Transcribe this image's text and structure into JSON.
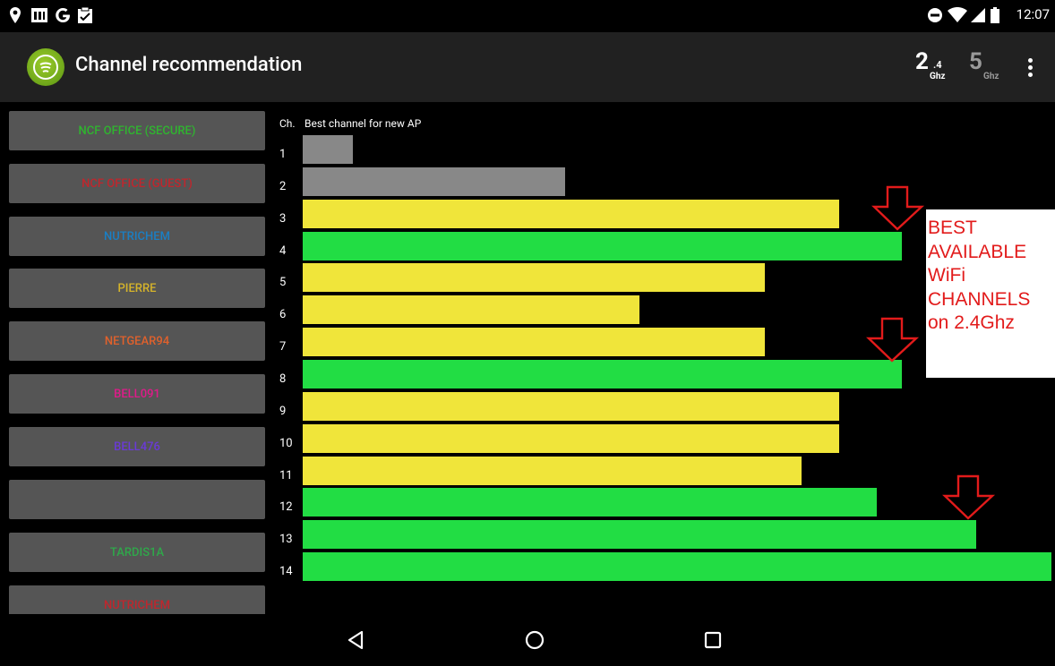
{
  "status_bar": {
    "time": "12:07",
    "left_icons": [
      "location-pin-icon",
      "news-icon",
      "google-icon",
      "clipboard-icon"
    ],
    "right_icons": [
      "do-not-disturb-icon",
      "wifi-icon",
      "cell-signal-icon",
      "battery-icon"
    ]
  },
  "app_bar": {
    "title": "Channel recommendation",
    "band_24": {
      "main": "2",
      "sup": ".4",
      "unit": "Ghz"
    },
    "band_5": {
      "main": "5",
      "unit": "Ghz"
    },
    "menu_icon": "overflow-menu-icon"
  },
  "networks": [
    {
      "name": "NCF OFFICE (SECURE)",
      "color": "#2fb52f"
    },
    {
      "name": "NCF OFFICE (GUEST)",
      "color": "#c0262d"
    },
    {
      "name": "NUTRICHEM",
      "color": "#1a7fc4"
    },
    {
      "name": "PIERRE",
      "color": "#d6b42a"
    },
    {
      "name": "NETGEAR94",
      "color": "#e0612c"
    },
    {
      "name": "BELL091",
      "color": "#e01a8a"
    },
    {
      "name": "BELL476",
      "color": "#6a3ad6"
    },
    {
      "name": "",
      "color": "#ffffff"
    },
    {
      "name": "TARDIS1A",
      "color": "#2fa84a"
    },
    {
      "name": "NUTRICHEM",
      "color": "#c0262d"
    }
  ],
  "chart_data": {
    "type": "bar",
    "orientation": "horizontal",
    "header_ch": "Ch.",
    "title": "Best channel for new AP",
    "categories": [
      "1",
      "2",
      "3",
      "4",
      "5",
      "6",
      "7",
      "8",
      "9",
      "10",
      "11",
      "12",
      "13",
      "14"
    ],
    "values": [
      0.067,
      0.35,
      0.716,
      0.8,
      0.617,
      0.45,
      0.617,
      0.8,
      0.716,
      0.716,
      0.666,
      0.767,
      0.9,
      1.0
    ],
    "bar_colors": [
      "#888888",
      "#888888",
      "#f0e53a",
      "#22dd44",
      "#f0e53a",
      "#f0e53a",
      "#f0e53a",
      "#22dd44",
      "#f0e53a",
      "#f0e53a",
      "#f0e53a",
      "#22dd44",
      "#22dd44",
      "#22dd44"
    ],
    "xlim": [
      0,
      1
    ]
  },
  "annotation": {
    "lines": [
      "BEST",
      "AVAILABLE",
      "WiFi",
      "CHANNELS",
      "on 2.4Ghz"
    ],
    "color": "#e21b1b",
    "arrows_at_channels": [
      "3",
      "7",
      "12"
    ]
  },
  "nav_bar": {
    "icons": [
      "back-icon",
      "home-icon",
      "recents-icon"
    ]
  }
}
